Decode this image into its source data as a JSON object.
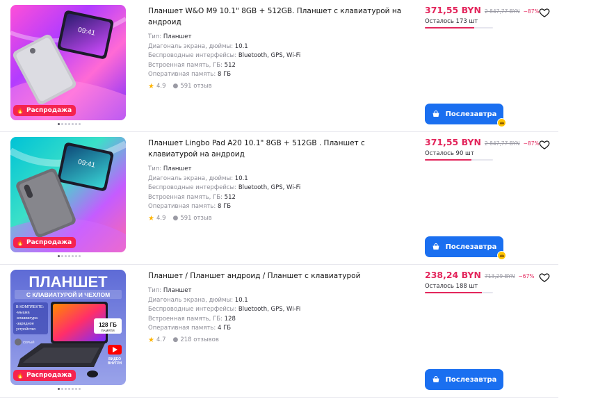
{
  "products": [
    {
      "title": "Планшет W&O M9 10.1\" 8GB + 512GB. Планшет с клавиатурой на андроид",
      "attrs": [
        {
          "label": "Тип:",
          "value": "Планшет"
        },
        {
          "label": "Диагональ экрана, дюймы:",
          "value": "10.1"
        },
        {
          "label": "Беспроводные интерфейсы:",
          "value": "Bluetooth, GPS, Wi-Fi"
        },
        {
          "label": "Встроенная память, ГБ:",
          "value": "512"
        },
        {
          "label": "Оперативная память:",
          "value": "8 ГБ"
        }
      ],
      "rating": "4.9",
      "reviews": "591 отзыв",
      "price": "371,55 BYN",
      "old_price": "2 847,77 BYN",
      "discount": "−87%",
      "stock": "Осталось 173 шт",
      "stock_level": 0.72,
      "badge": "Распродажа",
      "image_time": "09:41",
      "buy_label": "Послезавтра",
      "premium_mark": true
    },
    {
      "title": "Планшет Lingbo Pad A20 10.1\" 8GB + 512GB . Планшет с клавиатурой на андроид",
      "attrs": [
        {
          "label": "Тип:",
          "value": "Планшет"
        },
        {
          "label": "Диагональ экрана, дюймы:",
          "value": "10.1"
        },
        {
          "label": "Беспроводные интерфейсы:",
          "value": "Bluetooth, GPS, Wi-Fi"
        },
        {
          "label": "Встроенная память, ГБ:",
          "value": "512"
        },
        {
          "label": "Оперативная память:",
          "value": "8 ГБ"
        }
      ],
      "rating": "4.9",
      "reviews": "591 отзыв",
      "price": "371,55 BYN",
      "old_price": "2 847,77 BYN",
      "discount": "−87%",
      "stock": "Осталось 90 шт",
      "stock_level": 0.68,
      "badge": "Распродажа",
      "image_time": "09:41",
      "buy_label": "Послезавтра",
      "premium_mark": true
    },
    {
      "title": "Планшет / Планшет андроид / Планшет с клавиатурой",
      "attrs": [
        {
          "label": "Тип:",
          "value": "Планшет"
        },
        {
          "label": "Диагональ экрана, дюймы:",
          "value": "10.1"
        },
        {
          "label": "Беспроводные интерфейсы:",
          "value": "Bluetooth, GPS, Wi-Fi"
        },
        {
          "label": "Встроенная память, ГБ:",
          "value": "128"
        },
        {
          "label": "Оперативная память:",
          "value": "4 ГБ"
        }
      ],
      "rating": "4.7",
      "reviews": "218 отзывов",
      "price": "238,24 BYN",
      "old_price": "713,29 BYN",
      "discount": "−67%",
      "stock": "Осталось 188 шт",
      "stock_level": 0.84,
      "badge": "Распродажа",
      "promo": {
        "headline": "ПЛАНШЕТ",
        "subline": "С КЛАВИАТУРОЙ И ЧЕХЛОМ",
        "kit_lines": [
          "В КОМПЛЕКТЕ:",
          "-мышка",
          "-клавиатура",
          "-зарядное",
          "устройство"
        ],
        "memory": "128 ГБ",
        "memory_sub": "ПАМЯТИ",
        "color": "СЕРЫЙ",
        "video": "ВИДЕО",
        "video_sub": "ВНУТРИ"
      },
      "buy_label": "Послезавтра",
      "premium_mark": false
    }
  ],
  "colors": {
    "accent": "#1a6ff0",
    "price": "#e3265c",
    "badge": "#f5234f"
  },
  "icons": {
    "heart": "heart-icon",
    "cart": "cart-icon",
    "star": "star-icon",
    "reviews": "chat-bubble-icon",
    "fire": "fire-icon",
    "crown": "crown-icon"
  }
}
